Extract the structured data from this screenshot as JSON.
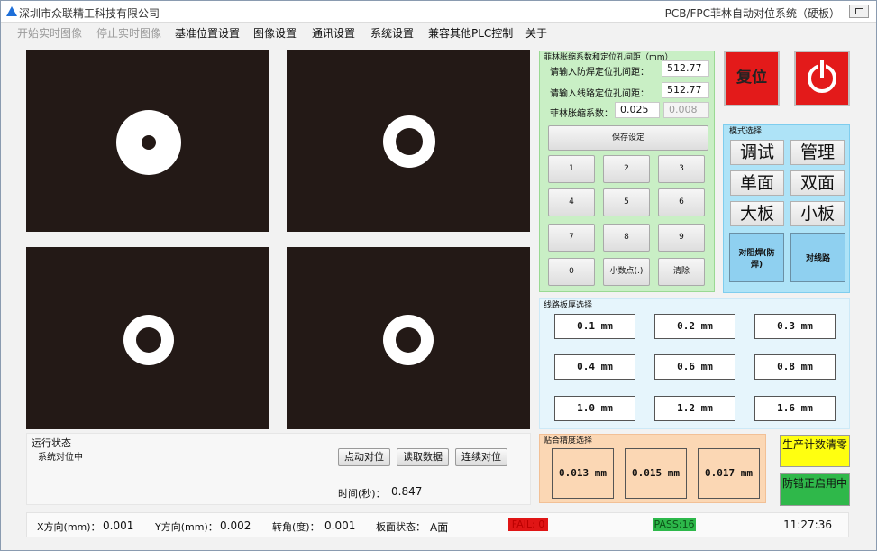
{
  "titlebar": {
    "company": "深圳市众联精工科技有限公司",
    "title": "PCB/FPC菲林自动对位系统（硬板）"
  },
  "menu": {
    "start_live": "开始实时图像",
    "stop_live": "停止实时图像",
    "base_position": "基准位置设置",
    "image_settings": "图像设置",
    "comm_settings": "通讯设置",
    "system_settings": "系统设置",
    "plc_compat": "兼容其他PLC控制",
    "about": "关于"
  },
  "status": {
    "title": "运行状态",
    "text": "系统对位中",
    "jog_align_btn": "点动对位",
    "read_data_btn": "读取数据",
    "continuous_align_btn": "连续对位",
    "time_label": "时间(秒)：",
    "time_value": "0.847"
  },
  "bottom": {
    "x_label": "X方向(mm)：",
    "x_value": "0.001",
    "y_label": "Y方向(mm)：",
    "y_value": "0.002",
    "rot_label": "转角(度)：",
    "rot_value": "0.001",
    "side_label": "板面状态：",
    "side_value": "A面",
    "fail": "FAIL: 0",
    "pass": "PASS:16",
    "clock": "11:27:36"
  },
  "calibration": {
    "title": "菲林胀缩系数和定位孔间距（mm）",
    "solder_label": "请输入防焊定位孔间距：",
    "solder_value": "512.77",
    "circuit_label": "请输入线路定位孔间距：",
    "circuit_value": "512.77",
    "coef_label": "菲林胀缩系数：",
    "coef_value": "0.025",
    "coef_value2": "0.008",
    "save_btn": "保存设定",
    "keys": [
      "1",
      "2",
      "3",
      "4",
      "5",
      "6",
      "7",
      "8",
      "9",
      "0",
      "小数点(.)",
      "清除"
    ]
  },
  "controls": {
    "reset": "复位"
  },
  "mode": {
    "title": "模式选择",
    "debug": "调试",
    "manage": "管理",
    "single": "单面",
    "double": "双面",
    "large": "大板",
    "small": "小板",
    "solder_align": "对阻焊(防焊)",
    "circuit_align": "对线路"
  },
  "thickness": {
    "title": "线路板厚选择",
    "options": [
      "0.1 mm",
      "0.2 mm",
      "0.3 mm",
      "0.4 mm",
      "0.6 mm",
      "0.8 mm",
      "1.0 mm",
      "1.2 mm",
      "1.6 mm"
    ]
  },
  "precision": {
    "title": "贴合精度选择",
    "options": [
      "0.013 mm",
      "0.015 mm",
      "0.017 mm"
    ]
  },
  "side_buttons": {
    "counter_reset": "生产计数清零",
    "error_proof": "防错正启用中"
  }
}
